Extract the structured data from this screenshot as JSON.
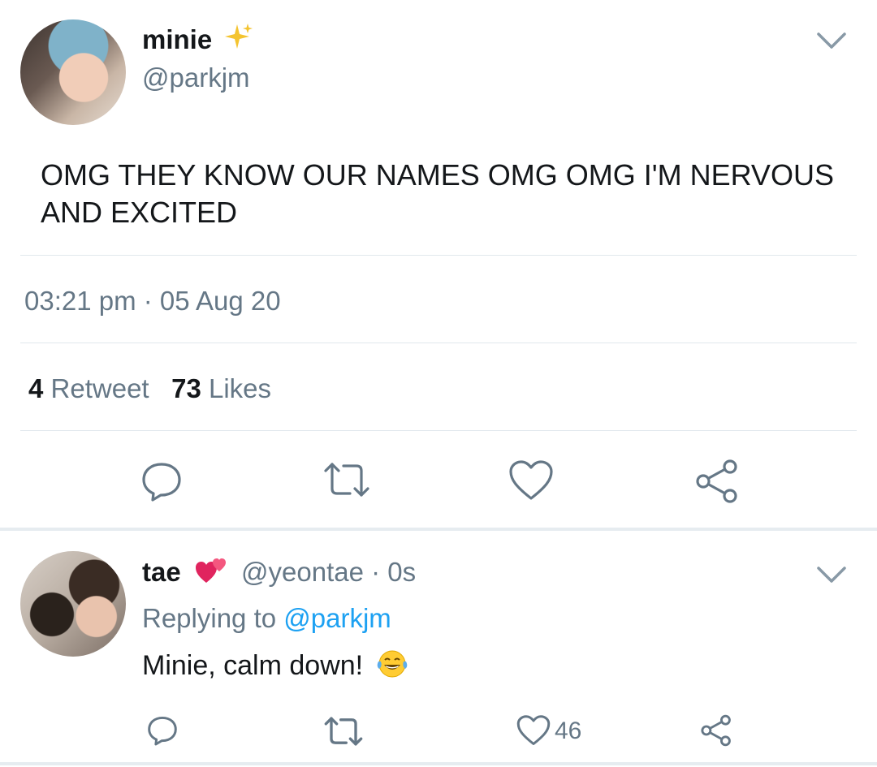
{
  "main_tweet": {
    "author_name": "minie",
    "name_emoji": "sparkles-icon",
    "handle": "@parkjm",
    "text": "OMG THEY KNOW OUR NAMES OMG OMG I'M NERVOUS AND EXCITED",
    "timestamp": "03:21 pm · 05 Aug 20",
    "retweet_count": "4",
    "retweet_label": "Retweet",
    "like_count": "73",
    "like_label": "Likes"
  },
  "reply_tweet": {
    "author_name": "tae",
    "name_emoji": "revolving-hearts-icon",
    "handle_and_time": "@yeontae · 0s",
    "replying_label": "Replying to",
    "replying_to": "@parkjm",
    "text": "Minie, calm down!",
    "text_emoji": "laughing-tears-icon",
    "like_count": "46"
  },
  "colors": {
    "text_primary": "#14171a",
    "text_secondary": "#657786",
    "link": "#1da1f2",
    "divider": "#e1e8ed"
  }
}
